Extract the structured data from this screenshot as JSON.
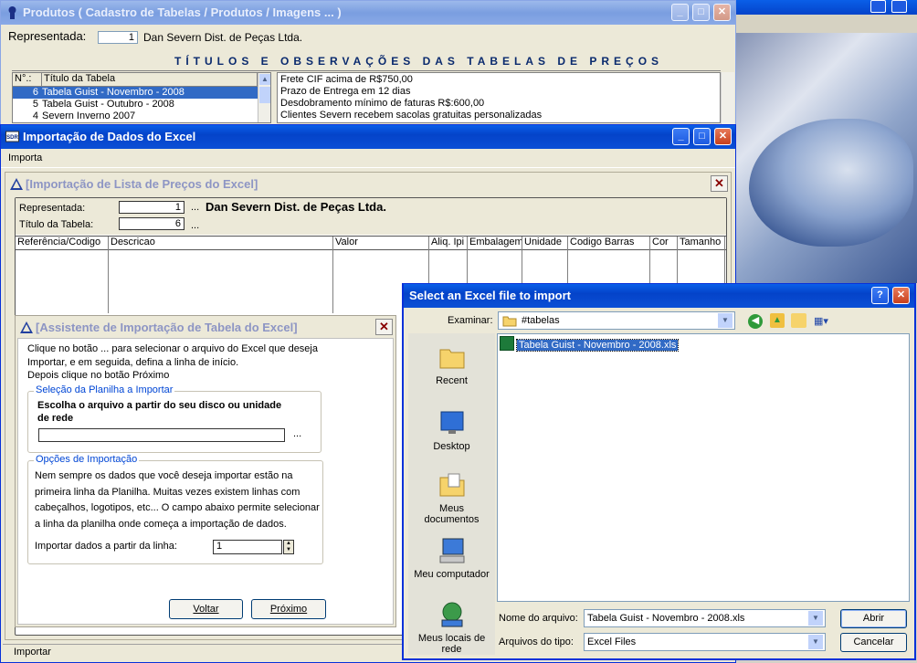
{
  "colors": {
    "xp_title_blue": "#0a5fe8",
    "selection": "#316ac5",
    "group_title": "#0046d5",
    "inner_title_text": "#8d95c4"
  },
  "produtos_window": {
    "title": "Produtos ( Cadastro de Tabelas / Produtos / Imagens ... )",
    "representada_label": "Representada:",
    "representada_code": "1",
    "representada_name": "Dan Severn Dist. de Peças Ltda.",
    "section_title": "TÍTULOS E OBSERVAÇÕES DAS TABELAS DE PREÇOS",
    "col_num": "N°.:",
    "col_titulo": "Título da Tabela",
    "tabelas": [
      {
        "num": "6",
        "title": "Tabela Guist - Novembro - 2008",
        "selected": true
      },
      {
        "num": "5",
        "title": "Tabela Guist - Outubro - 2008",
        "selected": false
      },
      {
        "num": "4",
        "title": "Severn Inverno 2007",
        "selected": false
      }
    ],
    "observacoes": [
      "Frete CIF acima de R$750,00",
      "Prazo de Entrega em 12 dias",
      "Desdobramento mínimo de faturas R$:600,00",
      "Clientes Severn recebem sacolas gratuitas personalizadas"
    ]
  },
  "importacao_window": {
    "title": "Importação de Dados do Excel",
    "menu_importa": "Importa",
    "status_text": "Importar"
  },
  "lista_window": {
    "title": "[Importação de Lista de Preços do Excel]",
    "representada_label": "Representada:",
    "representada_code": "1",
    "representada_dots": "...",
    "representada_name": "Dan Severn Dist. de Peças Ltda.",
    "titulo_label": "Título da Tabela:",
    "titulo_value": "6",
    "titulo_dots": "...",
    "columns": [
      "Referência/Codigo",
      "Descricao",
      "Valor",
      "Aliq. Ipi",
      "Embalagem",
      "Unidade",
      "Codigo Barras",
      "Cor",
      "Tamanho"
    ]
  },
  "assistente_window": {
    "title": "[Assistente de Importação de Tabela do Excel]",
    "intro_lines": [
      "Clique no botão ... para selecionar o arquivo do Excel que deseja",
      "Importar, e em seguida, defina a linha de início.",
      "Depois clique no botão Próximo"
    ],
    "group1_title": "Seleção da Planilha a Importar",
    "group1_label_l1": "Escolha o arquivo a partir do seu disco ou unidade",
    "group1_label_l2": "de rede",
    "file_value": "",
    "browse_dots": "...",
    "group2_title": "Opções de Importação",
    "group2_lines": [
      "Nem sempre os dados que você deseja importar estão na",
      "primeira linha da Planilha. Muitas vezes existem linhas com",
      "cabeçalhos, logotipos, etc... O campo abaixo permite selecionar",
      "a linha da planilha onde  começa a importação de dados."
    ],
    "linha_label": "Importar dados a partir da linha:",
    "linha_value": "1",
    "voltar_label": "Voltar",
    "proximo_label": "Próximo"
  },
  "file_dialog": {
    "title": "Select an Excel file to import",
    "examinar_label": "Examinar:",
    "current_folder": "#tabelas",
    "places": [
      {
        "label_l1": "Recent",
        "label_l2": "",
        "icon": "recent-folder-icon"
      },
      {
        "label_l1": "Desktop",
        "label_l2": "",
        "icon": "desktop-icon"
      },
      {
        "label_l1": "Meus",
        "label_l2": "documentos",
        "icon": "my-documents-icon"
      },
      {
        "label_l1": "Meu computador",
        "label_l2": "",
        "icon": "my-computer-icon"
      },
      {
        "label_l1": "Meus locais de",
        "label_l2": "rede",
        "icon": "network-places-icon"
      }
    ],
    "files": [
      {
        "name": "Tabela Guist - Novembro - 2008.xls",
        "selected": true
      }
    ],
    "filename_label": "Nome do arquivo:",
    "filename_value": "Tabela Guist - Novembro - 2008.xls",
    "filetype_label": "Arquivos do tipo:",
    "filetype_value": "Excel Files",
    "open_label": "Abrir",
    "cancel_label": "Cancelar"
  }
}
